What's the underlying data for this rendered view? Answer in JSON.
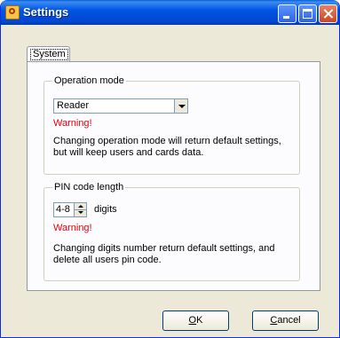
{
  "window": {
    "title": "Settings"
  },
  "tabs": [
    {
      "label": "System"
    }
  ],
  "operation_mode": {
    "legend": "Operation mode",
    "selected": "Reader",
    "warning": "Warning!",
    "note_line1": "Changing operation mode will return default settings,",
    "note_line2": "but will keep users and cards data."
  },
  "pin_length": {
    "legend": "PIN code length",
    "value": "4-8",
    "unit": "digits",
    "warning": "Warning!",
    "note_line1": "Changing digits number return default settings, and",
    "note_line2": "delete all users pin code."
  },
  "buttons": {
    "ok_accel": "O",
    "ok_rest": "K",
    "cancel_accel": "C",
    "cancel_rest": "ancel"
  },
  "colors": {
    "title_bar": "#0055e5",
    "warning": "#e8000b",
    "face": "#ece9d8"
  }
}
